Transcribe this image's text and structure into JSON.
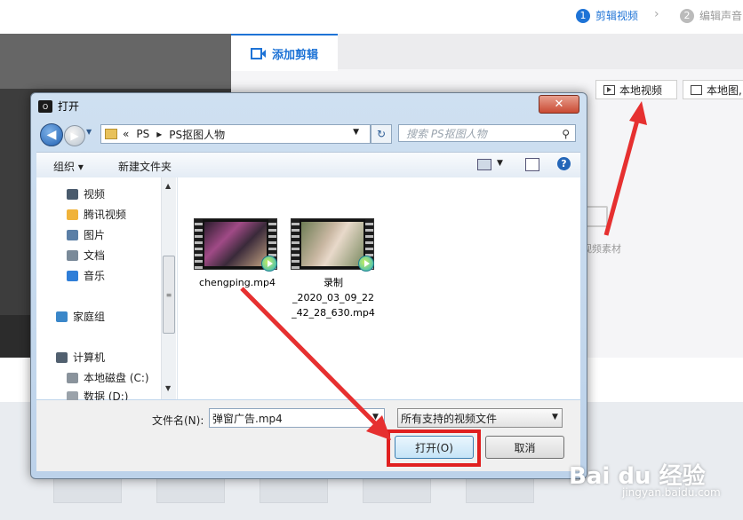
{
  "app": {
    "steps": [
      {
        "num": "1",
        "label": "剪辑视频"
      },
      {
        "num": "2",
        "label": "编辑声音"
      }
    ],
    "tab_add_clip": "添加剪辑",
    "btn_local_video": "本地视频",
    "btn_local_image": "本地图,",
    "video_material_label": "视频素材"
  },
  "dialog": {
    "title": "打开",
    "title_icon_text": "O",
    "address": {
      "prefix": "«",
      "crumbs": [
        "PS",
        "PS抠图人物"
      ]
    },
    "search_placeholder": "搜索 PS抠图人物",
    "toolbar": {
      "organize": "组织 ▾",
      "new_folder": "新建文件夹"
    },
    "nav_items": [
      {
        "label": "视频",
        "color": "#4a5b6d"
      },
      {
        "label": "腾讯视频",
        "color": "#f0b33a"
      },
      {
        "label": "图片",
        "color": "#5b7fa6"
      },
      {
        "label": "文档",
        "color": "#7a8a99"
      },
      {
        "label": "音乐",
        "color": "#2f7ed8"
      },
      {
        "label": "家庭组",
        "color": "#3a87c9"
      },
      {
        "label": "计算机",
        "color": "#51606f"
      },
      {
        "label": "本地磁盘 (C:)",
        "color": "#8a939c"
      },
      {
        "label": "数据 (D:)",
        "color": "#9aa2aa"
      }
    ],
    "files": [
      {
        "name": "chengping.mp4"
      },
      {
        "name": "录制\n_2020_03_09_22\n_42_28_630.mp4"
      }
    ],
    "filename_label": "文件名(N):",
    "filename_value": "弹窗广告.mp4",
    "filter_value": "所有支持的视频文件",
    "open_button": "打开(O)",
    "cancel_button": "取消"
  },
  "watermark": {
    "brand": "Bai du 经验",
    "url": "jingyan.baidu.com"
  }
}
